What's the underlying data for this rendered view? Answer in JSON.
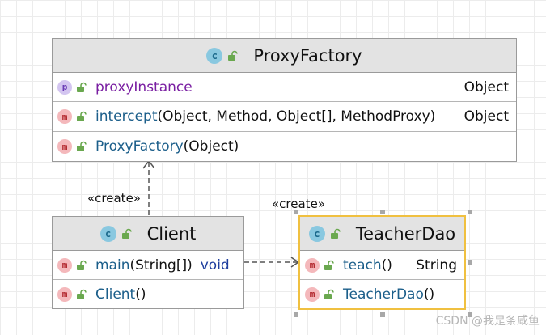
{
  "diagram": {
    "classes": {
      "proxy_factory": {
        "name": "ProxyFactory",
        "field": {
          "badge": "p",
          "name": "proxyInstance",
          "type": "Object"
        },
        "methods": [
          {
            "badge": "m",
            "name": "intercept",
            "params": "(Object, Method, Object[], MethodProxy)",
            "type": "Object"
          },
          {
            "badge": "m",
            "name": "ProxyFactory",
            "params": "(Object)"
          }
        ]
      },
      "client": {
        "name": "Client",
        "methods": [
          {
            "badge": "m",
            "name": "main",
            "params": "(String[])",
            "type": "void"
          },
          {
            "badge": "m",
            "name": "Client",
            "params": "()"
          }
        ]
      },
      "teacher_dao": {
        "name": "TeacherDao",
        "methods": [
          {
            "badge": "m",
            "name": "teach",
            "params": "()",
            "type": "String"
          },
          {
            "badge": "m",
            "name": "TeacherDao",
            "params": "()"
          }
        ]
      }
    },
    "class_badge": "c",
    "relations": [
      {
        "from": "Client",
        "to": "ProxyFactory",
        "label": "«create»"
      },
      {
        "from": "Client",
        "to": "TeacherDao",
        "label": "«create»"
      }
    ]
  },
  "watermark": "CSDN @我是条咸鱼",
  "colors": {
    "header_bg": "#e3e3e3",
    "selection": "#f0c040",
    "method_badge": "#f4b8bb",
    "property_badge": "#d3c5f0",
    "class_badge": "#89c8e0",
    "lock_green": "#6aa84f"
  }
}
